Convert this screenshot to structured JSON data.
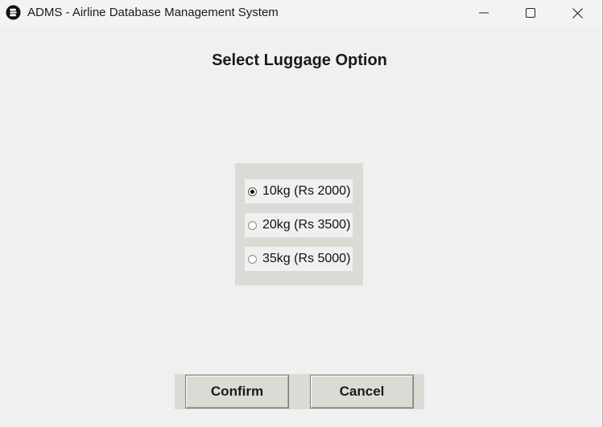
{
  "window": {
    "title": "ADMS - Airline Database Management System",
    "icon": "app-logo-icon",
    "controls": [
      "minimize-icon",
      "maximize-icon",
      "close-icon"
    ]
  },
  "main": {
    "heading": "Select Luggage Option",
    "options": [
      {
        "label": "10kg (Rs 2000)",
        "selected": true
      },
      {
        "label": "20kg (Rs 3500)",
        "selected": false
      },
      {
        "label": "35kg (Rs 5000)",
        "selected": false
      }
    ],
    "buttons": {
      "confirm_label": "Confirm",
      "cancel_label": "Cancel"
    }
  },
  "colors": {
    "window_bg": "#f0f0f0",
    "panel_bg": "#dcdad5",
    "text": "#1a1a1a"
  }
}
